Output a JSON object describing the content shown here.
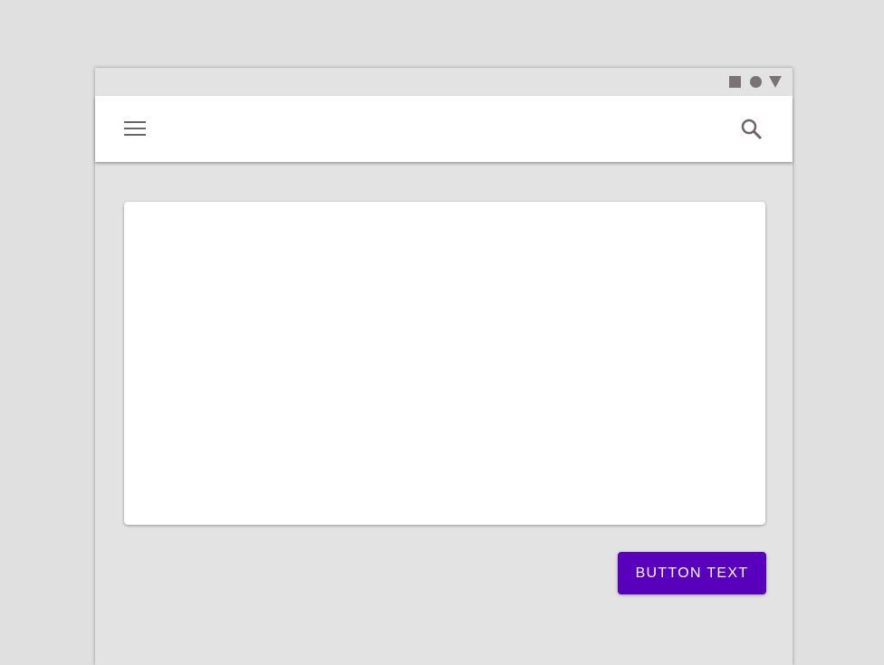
{
  "status_bar": {
    "icons": [
      "square-icon",
      "circle-icon",
      "triangle-icon"
    ],
    "icon_color": "#7a7276"
  },
  "app_bar": {
    "icons": [
      "menu-icon",
      "search-icon"
    ]
  },
  "actions": {
    "primary_button_label": "BUTTON TEXT",
    "primary_color": "#5800bb"
  }
}
